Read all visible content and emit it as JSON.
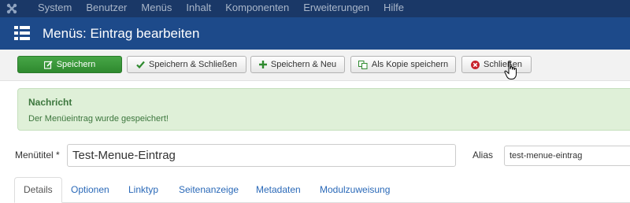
{
  "topbar": {
    "menu_items": [
      "System",
      "Benutzer",
      "Menüs",
      "Inhalt",
      "Komponenten",
      "Erweiterungen",
      "Hilfe"
    ]
  },
  "titlebar": {
    "title": "Menüs: Eintrag bearbeiten"
  },
  "toolbar": {
    "save_label": "Speichern",
    "save_close_label": "Speichern & Schließen",
    "save_new_label": "Speichern & Neu",
    "save_copy_label": "Als Kopie speichern",
    "close_label": "Schließen"
  },
  "message": {
    "heading": "Nachricht",
    "text": "Der Menüeintrag wurde gespeichert!"
  },
  "form": {
    "title_label": "Menütitel *",
    "title_value": "Test-Menue-Eintrag",
    "alias_label": "Alias",
    "alias_value": "test-menue-eintrag"
  },
  "tabs": [
    "Details",
    "Optionen",
    "Linktyp",
    "Seitenanzeige",
    "Metadaten",
    "Modulzuweisung"
  ],
  "colors": {
    "topbar": "#1a3867",
    "titlebar": "#1d4a8a",
    "save_button": "#3f9e3f",
    "alert_background": "#dff0d8",
    "alert_text": "#3c763d",
    "tab_link": "#2a69b8"
  }
}
